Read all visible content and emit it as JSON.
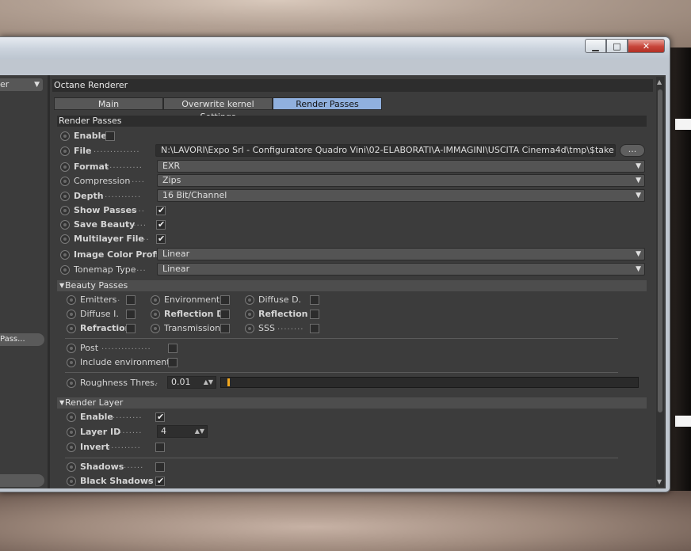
{
  "window": {
    "min_label": "▁",
    "max_label": "□",
    "close_label": "✕"
  },
  "left_panel": {
    "dropdown_label": "er",
    "button1_label": "Pass...",
    "button2_label": ""
  },
  "panel": {
    "title": "Octane Renderer",
    "tabs": [
      "Main",
      "Overwrite kernel Settings",
      "Render Passes"
    ],
    "active_tab": "Render Passes"
  },
  "render_passes": {
    "section_title": "Render Passes",
    "enable_label": "Enable",
    "file_label": "File",
    "file_value": "N:\\LAVORI\\Expo Srl - Configuratore Quadro Vini\\02-ELABORATI\\A-IMMAGINI\\USCITA Cinema4d\\tmp\\$take",
    "browse_label": "...",
    "format_label": "Format",
    "format_value": "EXR",
    "compression_label": "Compression",
    "compression_value": "Zips",
    "depth_label": "Depth",
    "depth_value": "16 Bit/Channel",
    "show_passes_label": "Show Passes",
    "save_beauty_label": "Save Beauty",
    "multilayer_label": "Multilayer File",
    "image_color_profile_label": "Image Color Profile",
    "image_color_profile_value": "Linear",
    "tonemap_type_label": "Tonemap Type",
    "tonemap_type_value": "Linear"
  },
  "beauty_passes": {
    "title": "Beauty Passes",
    "col1": [
      "Emitters",
      "Diffuse I.",
      "Refraction"
    ],
    "col2": [
      "Environment",
      "Reflection D.",
      "Transmission"
    ],
    "col3": [
      "Diffuse D.",
      "Reflection I.",
      "SSS"
    ],
    "post_label": "Post",
    "include_env_label": "Include environment",
    "roughness_label": "Roughness Thres.",
    "roughness_value": "0.01",
    "roughness_fraction": 0.01
  },
  "render_layer": {
    "title": "Render Layer",
    "enable_label": "Enable",
    "layer_id_label": "Layer ID",
    "layer_id_value": "4",
    "invert_label": "Invert",
    "shadows_label": "Shadows",
    "black_shadows_label": "Black Shadows"
  },
  "glyphs": {
    "dropdown_arrow": "▼",
    "spin_arrows": "▲▼",
    "section_caret": "▼",
    "scroll_up": "▲",
    "scroll_down": "▼"
  }
}
